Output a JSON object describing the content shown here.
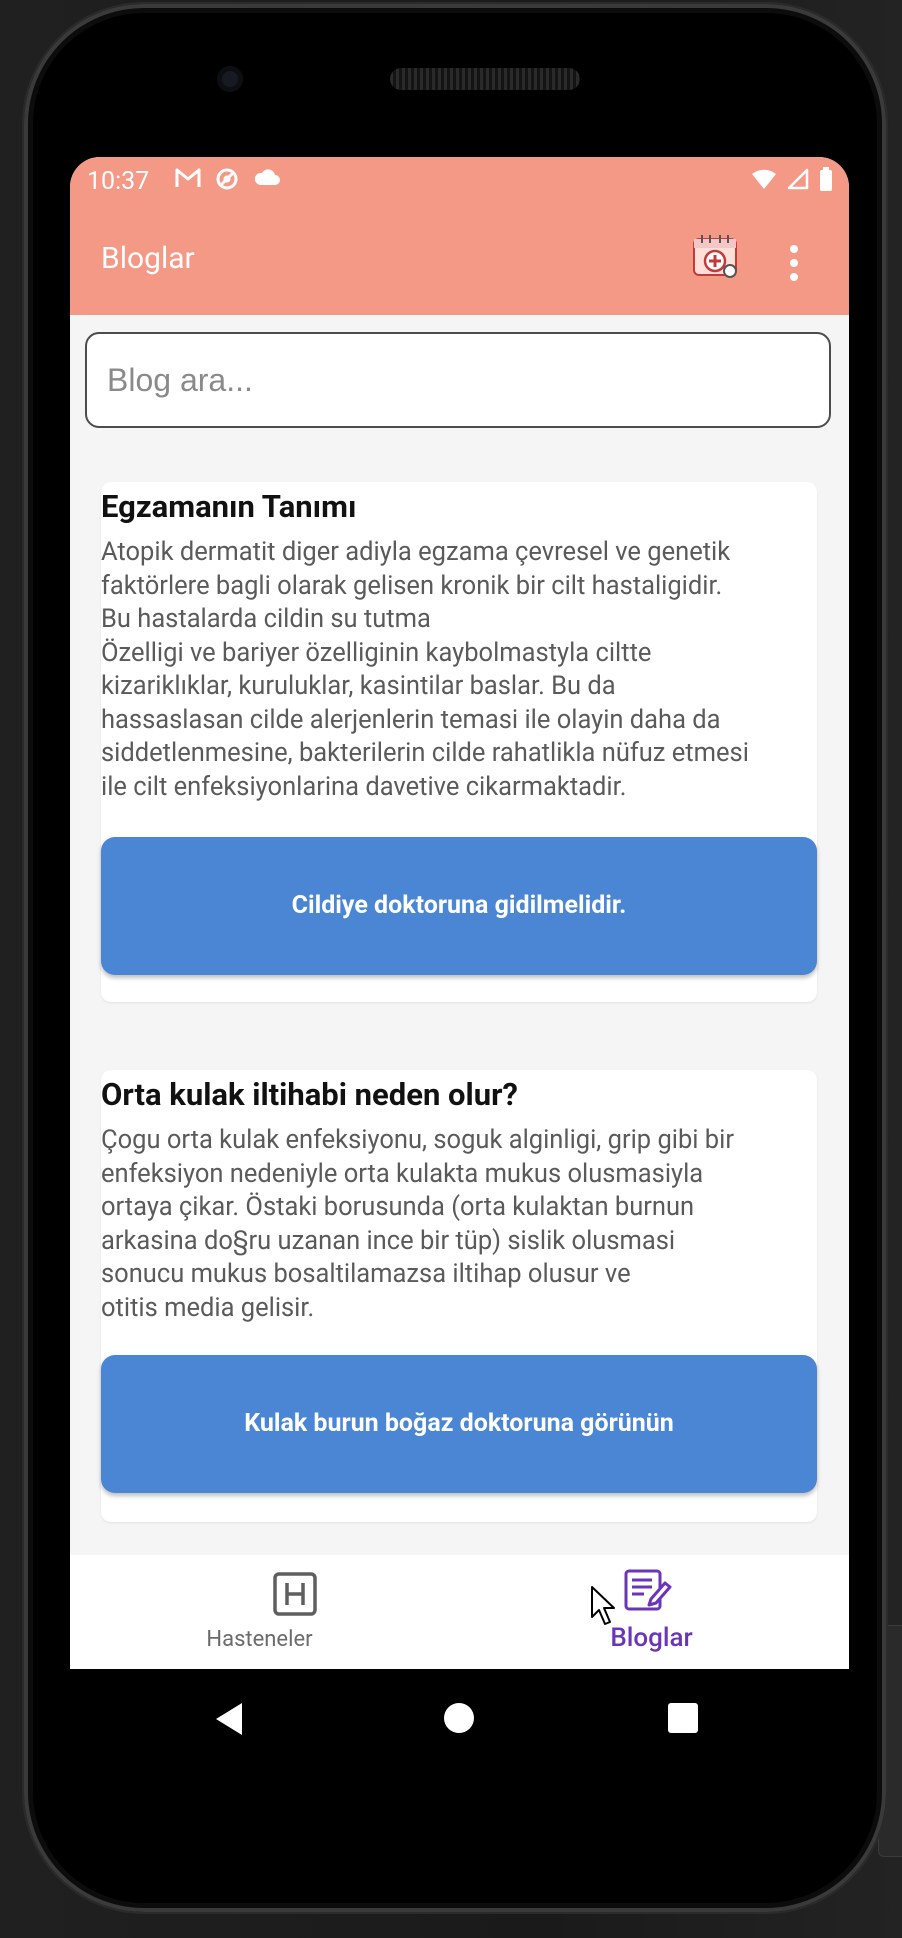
{
  "status_bar": {
    "time": "10:37",
    "left_icons": [
      "gmail-icon",
      "sync-icon",
      "cloud-icon"
    ],
    "right_icons": [
      "wifi-icon",
      "signal-icon",
      "battery-icon"
    ]
  },
  "app_bar": {
    "title": "Bloglar",
    "action_icon": "medical-calendar-icon",
    "overflow_icon": "more-vert-icon"
  },
  "search": {
    "placeholder": "Blog ara..."
  },
  "blogs": [
    {
      "title": "Egzamanın Tanımı",
      "body": "Atopik dermatit diger adiyla egzama çevresel ve genetik\nfaktörlere bagli olarak gelisen kronik bir cilt hastaligidir.\nBu hastalarda cildin su tutma\nÖzelligi ve bariyer özelliginin kaybolmastyla ciltte\nkizariklıklar, kuruluklar, kasintilar baslar. Bu da\nhassaslasan cilde alerjenlerin temasi ile olayin daha da\nsiddetlenmesine, bakterilerin cilde rahatlikla nüfuz etmesi\nile cilt enfeksiyonlarina davetive cikarmaktadir.",
      "button": "Cildiye doktoruna gidilmelidir."
    },
    {
      "title": "Orta kulak iltihabi neden olur?",
      "body": "Çogu orta kulak enfeksiyonu, soguk alginligi, grip gibi bir\nenfeksiyon nedeniyle orta kulakta mukus olusmasiyla\nortaya çikar. Östaki borusunda (orta kulaktan burnun\narkasina do§ru uzanan ince bir tüp) sislik olusmasi\nsonucu mukus bosaltilamazsa iltihap olusur ve\notitis media gelisir.",
      "button": "Kulak burun boğaz doktoruna görünün"
    }
  ],
  "bottom_nav": {
    "items": [
      {
        "label": "Hasteneler",
        "icon": "hospital-h-icon",
        "active": false
      },
      {
        "label": "Bloglar",
        "icon": "edit-note-icon",
        "active": true
      }
    ]
  },
  "colors": {
    "app_bar": "#f59987",
    "button": "#4a86d4",
    "active_nav": "#6a35b8",
    "inactive_nav": "#6b6b6b"
  }
}
